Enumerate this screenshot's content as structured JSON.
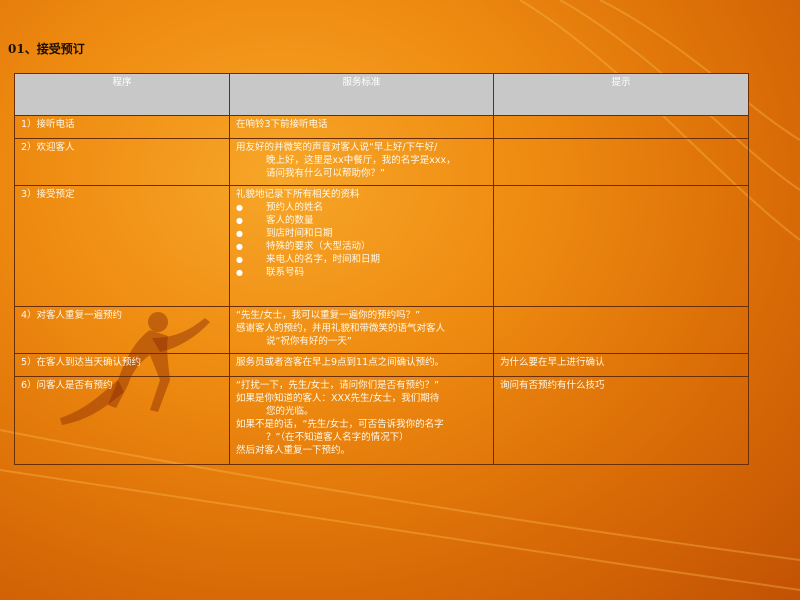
{
  "section_title": "01、接受预订",
  "table": {
    "headers": {
      "procedure": "程序",
      "standard": "服务标准",
      "tips": "提示"
    },
    "rows": [
      {
        "step": "1）接听电话",
        "std": [
          "在响铃3下前接听电话"
        ],
        "tip": ""
      },
      {
        "step": "2）欢迎客人",
        "std": [
          "用友好的并微笑的声音对客人说“早上好/下午好/",
          "晚上好，这里是xx中餐厅，我的名字是xxx，",
          "请问我有什么可以帮助你？”"
        ],
        "tip": ""
      },
      {
        "step": "3）接受预定",
        "std_intro": "礼貌地记录下所有相关的资料",
        "bullets": [
          "预约人的姓名",
          "客人的数量",
          "到店时间和日期",
          "特殊的要求（大型活动）",
          "来电人的名字，时间和日期",
          "联系号码"
        ],
        "tip": ""
      },
      {
        "step": "4）对客人重复一遍预约",
        "std": [
          "“先生/女士，我可以重复一遍你的预约吗？”",
          "感谢客人的预约，并用礼貌和带微笑的语气对客人",
          "说“祝你有好的一天”"
        ],
        "tip": ""
      },
      {
        "step": "5）在客人到达当天确认预约",
        "std": [
          "服务员或者咨客在早上9点到11点之间确认预约。"
        ],
        "tip": "为什么要在早上进行确认"
      },
      {
        "step": "6）问客人是否有预约",
        "std": [
          "“打扰一下，先生/女士，请问你们是否有预约？”",
          "如果是你知道的客人：XXX先生/女士，我们期待",
          "您的光临。",
          "如果不是的话，“先生/女士，可否告诉我你的名字",
          "？”（在不知道客人名字的情况下）",
          "然后对客人重复一下预约。"
        ],
        "tip": "询问有否预约有什么技巧"
      }
    ]
  },
  "colors": {
    "background": "#ee8a10",
    "header": "#c8c8c8",
    "border": "#6b2e02"
  }
}
